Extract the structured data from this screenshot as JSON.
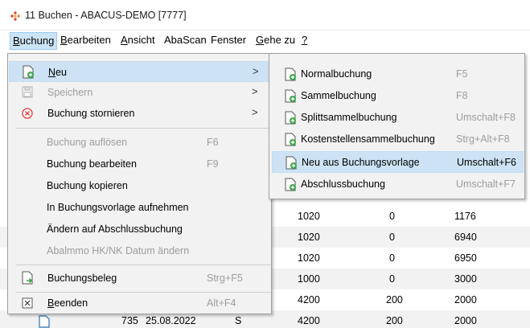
{
  "window": {
    "title": "11 Buchen - ABACUS-DEMO [7777]"
  },
  "menubar": {
    "items": [
      {
        "pre": "",
        "u": "B",
        "post": "uchung"
      },
      {
        "pre": "",
        "u": "B",
        "post": "earbeiten"
      },
      {
        "pre": "",
        "u": "A",
        "post": "nsicht"
      },
      {
        "pre": "AbaScan",
        "u": "",
        "post": ""
      },
      {
        "pre": "Fenster",
        "u": "",
        "post": ""
      },
      {
        "pre": "",
        "u": "G",
        "post": "ehe zu"
      },
      {
        "pre": "",
        "u": "?",
        "post": ""
      }
    ]
  },
  "menu": {
    "items": [
      {
        "label_u": "N",
        "label_rest": "eu",
        "arrow": ">"
      },
      {
        "label": "Speichern",
        "arrow": ">"
      },
      {
        "label": "Buchung stornieren",
        "arrow": ">"
      },
      {
        "label": "Buchung auflösen",
        "shortcut": "F6"
      },
      {
        "label": "Buchung bearbeiten",
        "shortcut": "F9"
      },
      {
        "label": "Buchung kopieren"
      },
      {
        "label": "In Buchungsvorlage aufnehmen"
      },
      {
        "label": "Ändern auf Abschlussbuchung"
      },
      {
        "label": "Abalmmo HK/NK Datum ändern"
      },
      {
        "label": "Buchungsbeleg",
        "shortcut": "Strg+F5"
      },
      {
        "label_u": "B",
        "label_rest": "eenden",
        "shortcut": "Alt+F4"
      }
    ]
  },
  "submenu": {
    "items": [
      {
        "label": "Normalbuchung",
        "shortcut": "F5"
      },
      {
        "label": "Sammelbuchung",
        "shortcut": "F8"
      },
      {
        "label": "Splittsammelbuchung",
        "shortcut": "Umschalt+F8"
      },
      {
        "label": "Kostenstellensammelbuchung",
        "shortcut": "Strg+Alt+F8"
      },
      {
        "label": "Neu aus Buchungsvorlage",
        "shortcut": "Umschalt+F6"
      },
      {
        "label": "Abschlussbuchung",
        "shortcut": "Umschalt+F7"
      }
    ]
  },
  "grid": {
    "rows": [
      {
        "c1": "1020",
        "c2": "0",
        "c3": "1176"
      },
      {
        "c1": "1020",
        "c2": "0",
        "c3": "6940"
      },
      {
        "c1": "1020",
        "c2": "0",
        "c3": "6950"
      },
      {
        "c1": "1000",
        "c2": "0",
        "c3": "3000"
      },
      {
        "c1": "4200",
        "c2": "200",
        "c3": "2000"
      },
      {
        "num": "735",
        "date": "25.08.2022",
        "type": "S",
        "c1": "4200",
        "c2": "200",
        "c3": "2000"
      }
    ]
  }
}
